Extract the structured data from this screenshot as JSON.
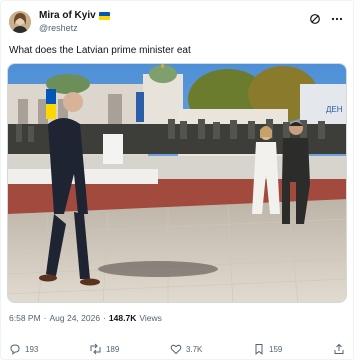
{
  "author": {
    "display_name": "Mira of Kyiv",
    "handle": "@reshetz"
  },
  "tweet": {
    "text": "What does the Latvian prime minister eat"
  },
  "media": {
    "screen_text": "ДЕН"
  },
  "meta": {
    "time": "6:58 PM",
    "separator": "·",
    "date": "Aug 24, 2026",
    "views_count": "148.7K",
    "views_label": "Views"
  },
  "actions": {
    "replies": "193",
    "reposts": "189",
    "likes": "3.7K",
    "bookmarks": "159"
  },
  "colors": {
    "accent": "#1d9bf0",
    "muted": "#536471",
    "text": "#0f1419"
  },
  "icons": [
    "grok-icon",
    "more-icon",
    "reply-icon",
    "repost-icon",
    "like-icon",
    "bookmark-icon",
    "share-icon"
  ]
}
